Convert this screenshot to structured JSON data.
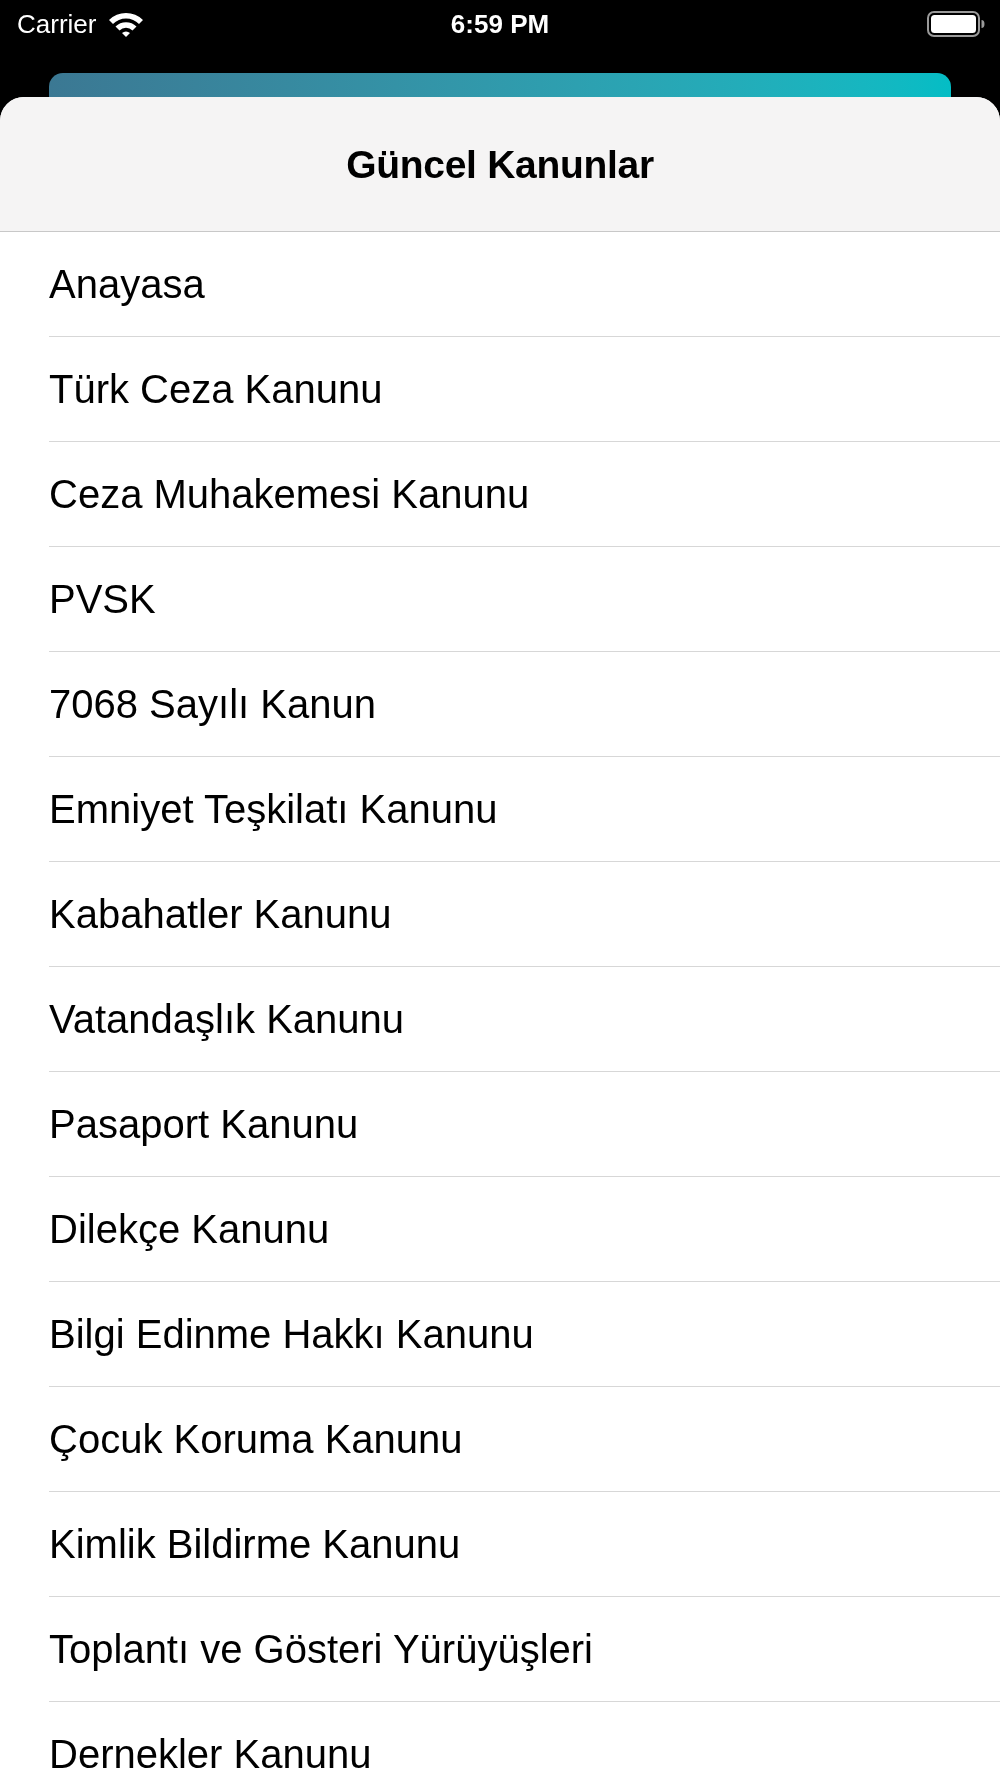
{
  "status_bar": {
    "carrier": "Carrier",
    "time": "6:59 PM"
  },
  "sheet": {
    "title": "Güncel Kanunlar",
    "items": [
      "Anayasa",
      "Türk Ceza Kanunu",
      "Ceza Muhakemesi Kanunu",
      "PVSK",
      "7068 Sayılı Kanun",
      "Emniyet Teşkilatı Kanunu",
      "Kabahatler Kanunu",
      "Vatandaşlık Kanunu",
      "Pasaport Kanunu",
      "Dilekçe Kanunu",
      "Bilgi Edinme Hakkı Kanunu",
      "Çocuk Koruma Kanunu",
      "Kimlik Bildirme Kanunu",
      "Toplantı ve Gösteri Yürüyüşleri",
      "Dernekler Kanunu"
    ]
  }
}
